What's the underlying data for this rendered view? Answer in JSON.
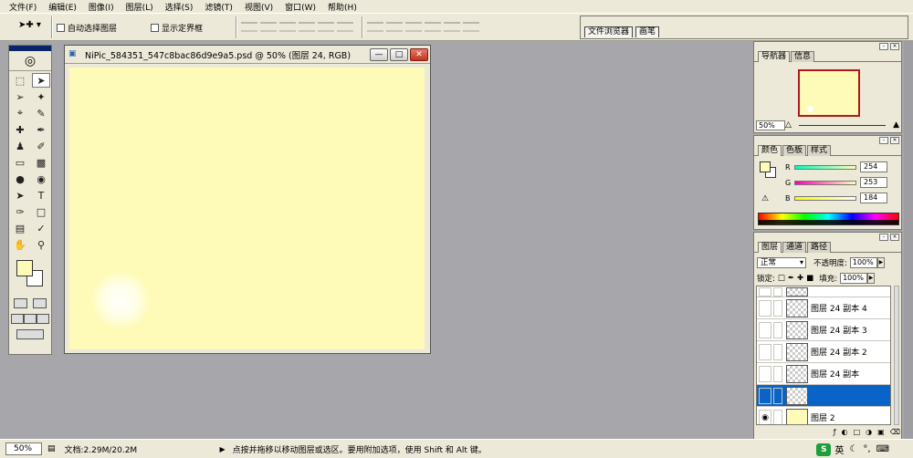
{
  "menu": [
    "文件(F)",
    "编辑(E)",
    "图像(I)",
    "图层(L)",
    "选择(S)",
    "滤镜(T)",
    "视图(V)",
    "窗口(W)",
    "帮助(H)"
  ],
  "options": {
    "auto_select_label": "自动选择图层",
    "show_bounds_label": "显示定界框",
    "well_tabs": [
      "文件浏览器",
      "画笔"
    ]
  },
  "document": {
    "title": "NiPic_584351_547c8bac86d9e9a5.psd @ 50% (图层 24, RGB)",
    "canvas_color": "#fefbb8"
  },
  "navigator": {
    "tabs": [
      "导航器",
      "信息"
    ],
    "zoom": "50%"
  },
  "color": {
    "tabs": [
      "颜色",
      "色板",
      "样式"
    ],
    "r_label": "R",
    "r": "254",
    "g_label": "G",
    "g": "253",
    "b_label": "B",
    "b": "184",
    "foreground": "#fefbb8"
  },
  "layers": {
    "tabs": [
      "图层",
      "通道",
      "路径"
    ],
    "blend_mode": "正常",
    "opacity_label": "不透明度:",
    "opacity": "100%",
    "lock_label": "锁定:",
    "fill_label": "填充:",
    "fill": "100%",
    "items": [
      {
        "name": "",
        "visible": false
      },
      {
        "name": "图层 24 副本 4",
        "visible": false
      },
      {
        "name": "图层 24 副本 3",
        "visible": false
      },
      {
        "name": "图层 24 副本 2",
        "visible": false
      },
      {
        "name": "图层 24 副本",
        "visible": false
      },
      {
        "name": "",
        "visible": false,
        "selected": true
      },
      {
        "name": "图层 2",
        "visible": true
      }
    ]
  },
  "status": {
    "zoom": "50%",
    "doc_info": "文档:2.29M/20.2M",
    "hint": "点按并拖移以移动图层或选区。要用附加选项，使用 Shift 和 Alt 键。",
    "ime": "英"
  }
}
